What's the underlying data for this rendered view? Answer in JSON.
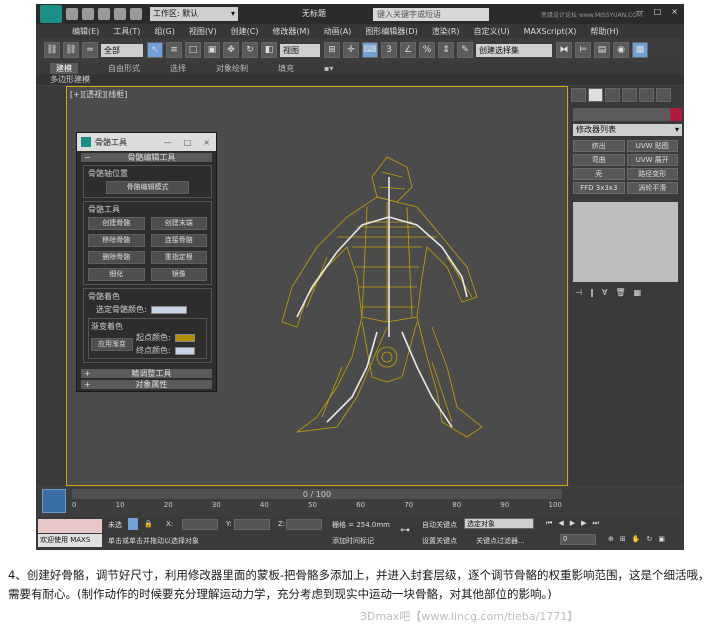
{
  "titlebar": {
    "workspace_label": "工作区: 默认",
    "window_title": "无标题",
    "search_placeholder": "键入关键字或短语",
    "watermark": "思缘设计论坛 www.MISSYUAN.COM",
    "min": "—",
    "max": "□",
    "close": "×"
  },
  "menubar": {
    "items": [
      "编辑(E)",
      "工具(T)",
      "组(G)",
      "视图(V)",
      "创建(C)",
      "修改器(M)",
      "动画(A)",
      "图形编辑器(D)",
      "渲染(R)",
      "自定义(U)",
      "MAXScript(X)",
      "帮助(H)"
    ]
  },
  "toolbar": {
    "filter_value": "全部",
    "view_value": "视图",
    "selection_set": "创建选择集"
  },
  "ribbon": {
    "tabs": [
      "建模",
      "自由形式",
      "选择",
      "对象绘制",
      "填充"
    ],
    "active_tab": "建模",
    "subpanel": "多边形建模"
  },
  "viewport": {
    "label": "[+][透视][线框]",
    "wire_color": "#c8a100"
  },
  "command_panel": {
    "modifier_list": "修改器列表",
    "modifiers": [
      "挤出",
      "UVW 贴图",
      "弯曲",
      "UVW 展开",
      "壳",
      "路径变形",
      "FFD 3x3x3",
      "涡轮平滑"
    ],
    "name_color": "#b01b3d"
  },
  "bone_dialog": {
    "title": "骨骼工具",
    "rollout_main": "骨骼编辑工具",
    "group_pivot": "骨骼轴位置",
    "btn_edit_mode": "骨骼编辑模式",
    "group_tools": "骨骼工具",
    "tools": [
      "创建骨骼",
      "创建末端",
      "移除骨骼",
      "连接骨骼",
      "删除骨骼",
      "重指定根",
      "细化",
      "镜像"
    ],
    "group_color": "骨骼着色",
    "selected_color_label": "选定骨骼颜色:",
    "gradient_label": "渐变着色",
    "apply_gradient": "应用渐变",
    "start_color_label": "起点颜色:",
    "end_color_label": "终点颜色:",
    "selected_color": "#c7d3e6",
    "start_color": "#b78e00",
    "end_color": "#c7d3e6",
    "rollout_fin": "鳍调整工具",
    "rollout_obj": "对象属性"
  },
  "timeline": {
    "frame_display": "0 / 100",
    "ticks": [
      "0",
      "10",
      "20",
      "30",
      "40",
      "50",
      "60",
      "70",
      "80",
      "90",
      "100"
    ]
  },
  "statusbar": {
    "welcome": "欢迎使用 MAXS",
    "selected": "未选",
    "x_label": "X:",
    "y_label": "Y:",
    "z_label": "Z:",
    "grid": "栅格 = 254.0mm",
    "auto_key": "自动关键点",
    "set_key": "设置关键点",
    "selected_object": "选定对象",
    "key_filter": "关键点过滤器...",
    "prompt": "单击或单击并拖动以选择对象",
    "add_time_tag": "添加时间标记",
    "frame_value": "0"
  },
  "caption": {
    "text": "4、创建好骨骼，调节好尺寸，利用修改器里面的蒙板-把骨骼多添加上，并进入封套层级，逐个调节骨骼的权重影响范围，这是个细活哦，需要有耐心。(制作动作的时候要充分理解运动力学，充分考虑到现实中运动一块骨骼，对其他部位的影响。)",
    "credit": "3Dmax吧【www.lincg.com/tieba/1771】"
  }
}
